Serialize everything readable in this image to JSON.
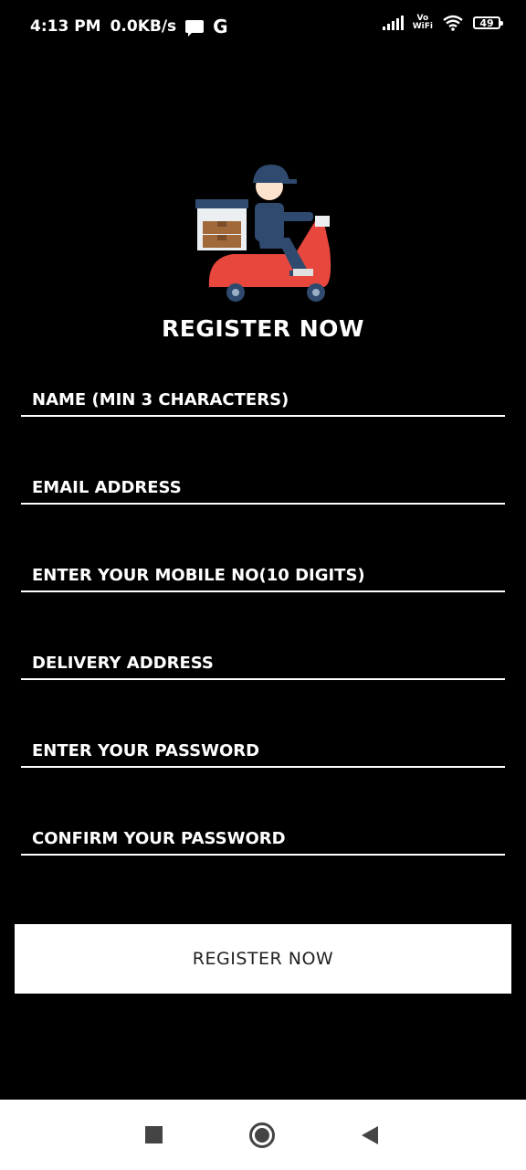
{
  "status_bar": {
    "time": "4:13 PM",
    "speed": "0.0KB/s",
    "g_label": "G",
    "volte_top": "Vo",
    "volte_bottom": "WiFi",
    "battery": "49"
  },
  "logo": {
    "icon": "delivery-scooter-icon"
  },
  "title": "REGISTER NOW",
  "form": {
    "name_placeholder": "NAME (MIN 3 CHARACTERS)",
    "email_placeholder": "EMAIL ADDRESS",
    "mobile_placeholder": "ENTER YOUR MOBILE NO(10 DIGITS)",
    "address_placeholder": "DELIVERY ADDRESS",
    "password_placeholder": "ENTER YOUR PASSWORD",
    "confirm_password_placeholder": "CONFIRM YOUR PASSWORD",
    "submit_label": "REGISTER NOW"
  },
  "colors": {
    "background": "#000000",
    "button": "#FFFFFF",
    "scooter": "#E8473E",
    "rider": "#2F4A6E"
  }
}
